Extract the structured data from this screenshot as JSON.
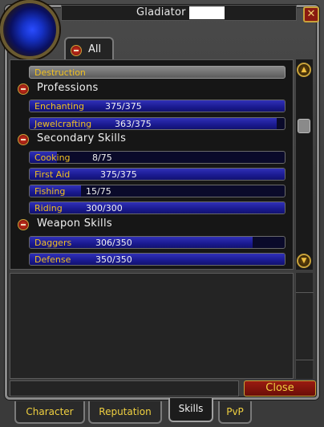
{
  "window": {
    "title": "Gladiator",
    "close_glyph": "✕"
  },
  "filter": {
    "label": "All"
  },
  "skills": {
    "collapsed_header": "Destruction",
    "sections": [
      {
        "title": "Professions",
        "items": [
          {
            "name": "Enchanting",
            "rank": "375/375",
            "progress": 1.0
          },
          {
            "name": "Jewelcrafting",
            "rank": "363/375",
            "progress": 0.968
          }
        ]
      },
      {
        "title": "Secondary Skills",
        "items": [
          {
            "name": "Cooking",
            "rank": "8/75",
            "progress": 0.107
          },
          {
            "name": "First Aid",
            "rank": "375/375",
            "progress": 1.0
          },
          {
            "name": "Fishing",
            "rank": "15/75",
            "progress": 0.2
          },
          {
            "name": "Riding",
            "rank": "300/300",
            "progress": 1.0
          }
        ]
      },
      {
        "title": "Weapon Skills",
        "items": [
          {
            "name": "Daggers",
            "rank": "306/350",
            "progress": 0.874
          },
          {
            "name": "Defense",
            "rank": "350/350",
            "progress": 1.0
          }
        ]
      }
    ]
  },
  "scroll": {
    "up_glyph": "▲",
    "down_glyph": "▼"
  },
  "buttons": {
    "close_label": "Close"
  },
  "tabs": [
    {
      "label": "Character",
      "active": false
    },
    {
      "label": "Reputation",
      "active": false
    },
    {
      "label": "Skills",
      "active": true
    },
    {
      "label": "PvP",
      "active": false
    }
  ],
  "colors": {
    "skill_name": "#f0c020",
    "skill_bar_fill": "#1a1a90",
    "close_button": "#8a1a10",
    "accent_gold": "#c8a23a"
  },
  "icons": {
    "portrait": "character-portrait-icon",
    "collapse": "minus-icon",
    "scroll_up": "scroll-up-icon",
    "scroll_down": "scroll-down-icon"
  }
}
